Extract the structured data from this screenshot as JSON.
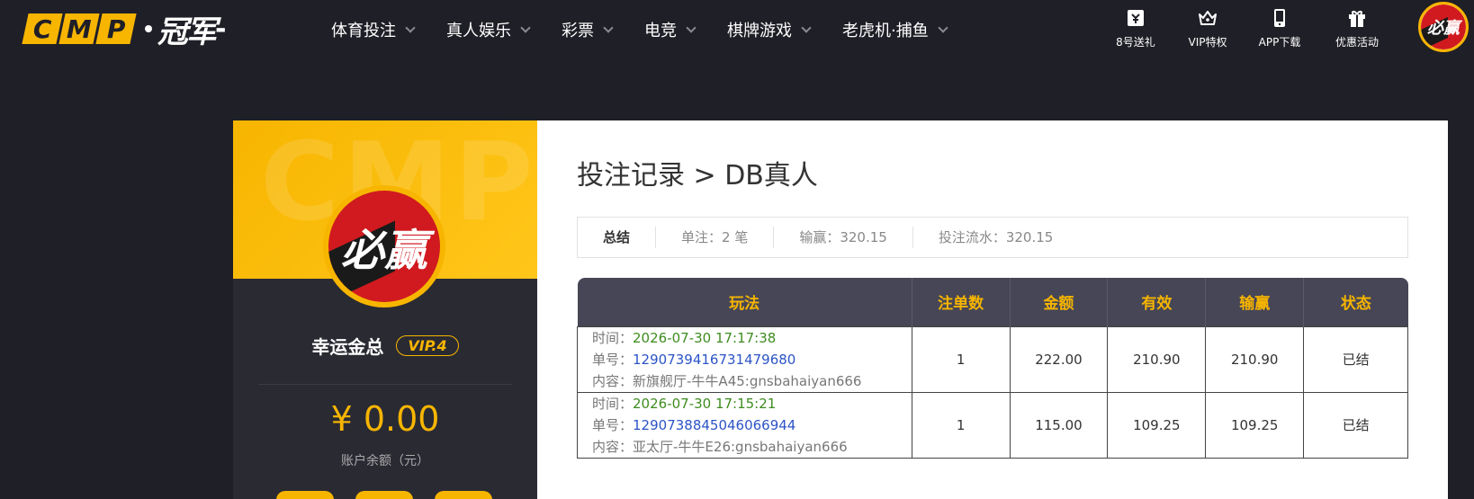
{
  "header": {
    "logo_letters": [
      "C",
      "M",
      "P"
    ],
    "logo_cn": "冠军",
    "nav": [
      {
        "label": "体育投注"
      },
      {
        "label": "真人娱乐"
      },
      {
        "label": "彩票"
      },
      {
        "label": "电竞"
      },
      {
        "label": "棋牌游戏"
      },
      {
        "label": "老虎机·捕鱼"
      }
    ],
    "tools": [
      {
        "label": "8号送礼",
        "icon": "gift-ticket-icon"
      },
      {
        "label": "VIP特权",
        "icon": "crown-icon"
      },
      {
        "label": "APP下载",
        "icon": "phone-icon"
      },
      {
        "label": "优惠活动",
        "icon": "gift-box-icon"
      }
    ],
    "avatar_text": "必赢"
  },
  "profile": {
    "watermark": "CMP",
    "avatar_text": "必赢",
    "username": "幸运金总",
    "vip": "VIP.4",
    "balance": "¥ 0.00",
    "balance_label": "账户余额（元）"
  },
  "main": {
    "title": "投注记录 > DB真人",
    "summary": {
      "label": "总结",
      "bets": "单注：2 笔",
      "win_loss": "输赢：320.15",
      "turnover": "投注流水：320.15"
    },
    "table": {
      "headers": [
        "玩法",
        "注单数",
        "金额",
        "有效",
        "输赢",
        "状态"
      ],
      "time_label": "时间：",
      "order_label": "单号：",
      "content_label": "内容：",
      "rows": [
        {
          "time": "2026-07-30 17:17:38",
          "order": "1290739416731479680",
          "content": "新旗舰厅-牛牛A45:gnsbahaiyan666",
          "count": "1",
          "amount": "222.00",
          "valid": "210.90",
          "win_loss": "210.90",
          "status": "已结"
        },
        {
          "time": "2026-07-30 17:15:21",
          "order": "1290738845046066944",
          "content": "亚太厅-牛牛E26:gnsbahaiyan666",
          "count": "1",
          "amount": "115.00",
          "valid": "109.25",
          "win_loss": "109.25",
          "status": "已结"
        }
      ]
    }
  },
  "colors": {
    "accent": "#f7b500",
    "background": "#1f1f27",
    "header_row": "#464656",
    "positive": "#3e8c20",
    "link": "#2c54c6"
  }
}
